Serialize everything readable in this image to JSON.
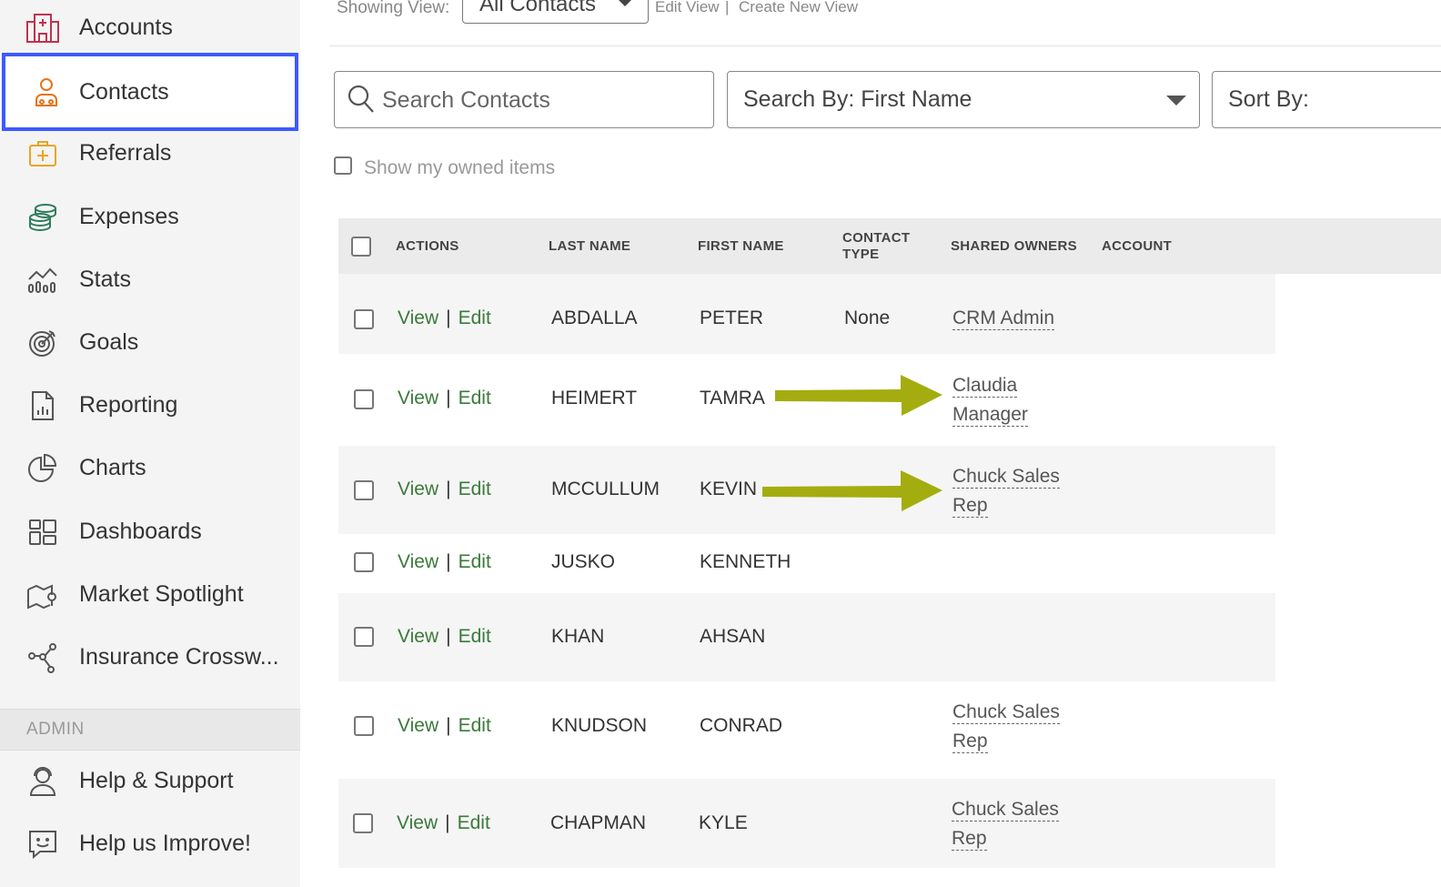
{
  "sidebar": {
    "items": [
      {
        "label": "Accounts",
        "icon": "hospital-icon"
      },
      {
        "label": "Contacts",
        "icon": "contacts-group-icon"
      },
      {
        "label": "Referrals",
        "icon": "medkit-icon"
      },
      {
        "label": "Expenses",
        "icon": "coins-icon"
      },
      {
        "label": "Stats",
        "icon": "stats-chart-icon"
      },
      {
        "label": "Goals",
        "icon": "target-icon"
      },
      {
        "label": "Reporting",
        "icon": "report-document-icon"
      },
      {
        "label": "Charts",
        "icon": "pie-chart-icon"
      },
      {
        "label": "Dashboards",
        "icon": "dashboard-grid-icon"
      },
      {
        "label": "Market Spotlight",
        "icon": "map-icon"
      },
      {
        "label": "Insurance Crossw...",
        "icon": "network-share-icon"
      }
    ],
    "admin_label": "ADMIN",
    "admin_items": [
      {
        "label": "Help & Support",
        "icon": "support-headset-icon"
      },
      {
        "label": "Help us Improve!",
        "icon": "feedback-chat-icon"
      }
    ],
    "active_color": "#3d5afe"
  },
  "viewbar": {
    "showing_label": "Showing View:",
    "view_value": "All Contacts",
    "edit_view": "Edit View",
    "separator": "|",
    "create_view": "Create New View"
  },
  "search": {
    "placeholder": "Search Contacts",
    "search_by_label": "Search By:",
    "search_by_value": "First Name",
    "sort_by_label": "Sort By:"
  },
  "owned_label": "Show my owned items",
  "table": {
    "headers": {
      "actions": "ACTIONS",
      "last_name": "LAST NAME",
      "first_name": "FIRST NAME",
      "contact_type_1": "CONTACT",
      "contact_type_2": "TYPE",
      "shared_owners": "SHARED OWNERS",
      "account": "ACCOUNT"
    },
    "view_label": "View",
    "edit_label": "Edit",
    "rows": [
      {
        "last": "ABDALLA",
        "first": "PETER",
        "type": "None",
        "owner1": "CRM Admin",
        "owner2": ""
      },
      {
        "last": "HEIMERT",
        "first": "TAMRA",
        "type": "",
        "owner1": "Claudia",
        "owner2": "Manager"
      },
      {
        "last": "MCCULLUM",
        "first": "KEVIN",
        "type": "",
        "owner1": "Chuck Sales",
        "owner2": "Rep"
      },
      {
        "last": "JUSKO",
        "first": "KENNETH",
        "type": "",
        "owner1": "",
        "owner2": ""
      },
      {
        "last": "KHAN",
        "first": "AHSAN",
        "type": "",
        "owner1": "",
        "owner2": ""
      },
      {
        "last": "KNUDSON",
        "first": "CONRAD",
        "type": "",
        "owner1": "Chuck Sales",
        "owner2": "Rep"
      },
      {
        "last": "CHAPMAN",
        "first": "KYLE",
        "type": "",
        "owner1": "Chuck Sales",
        "owner2": "Rep"
      }
    ]
  },
  "colors": {
    "action_link": "#3a7a3a",
    "arrow": "#a4ad0f"
  }
}
